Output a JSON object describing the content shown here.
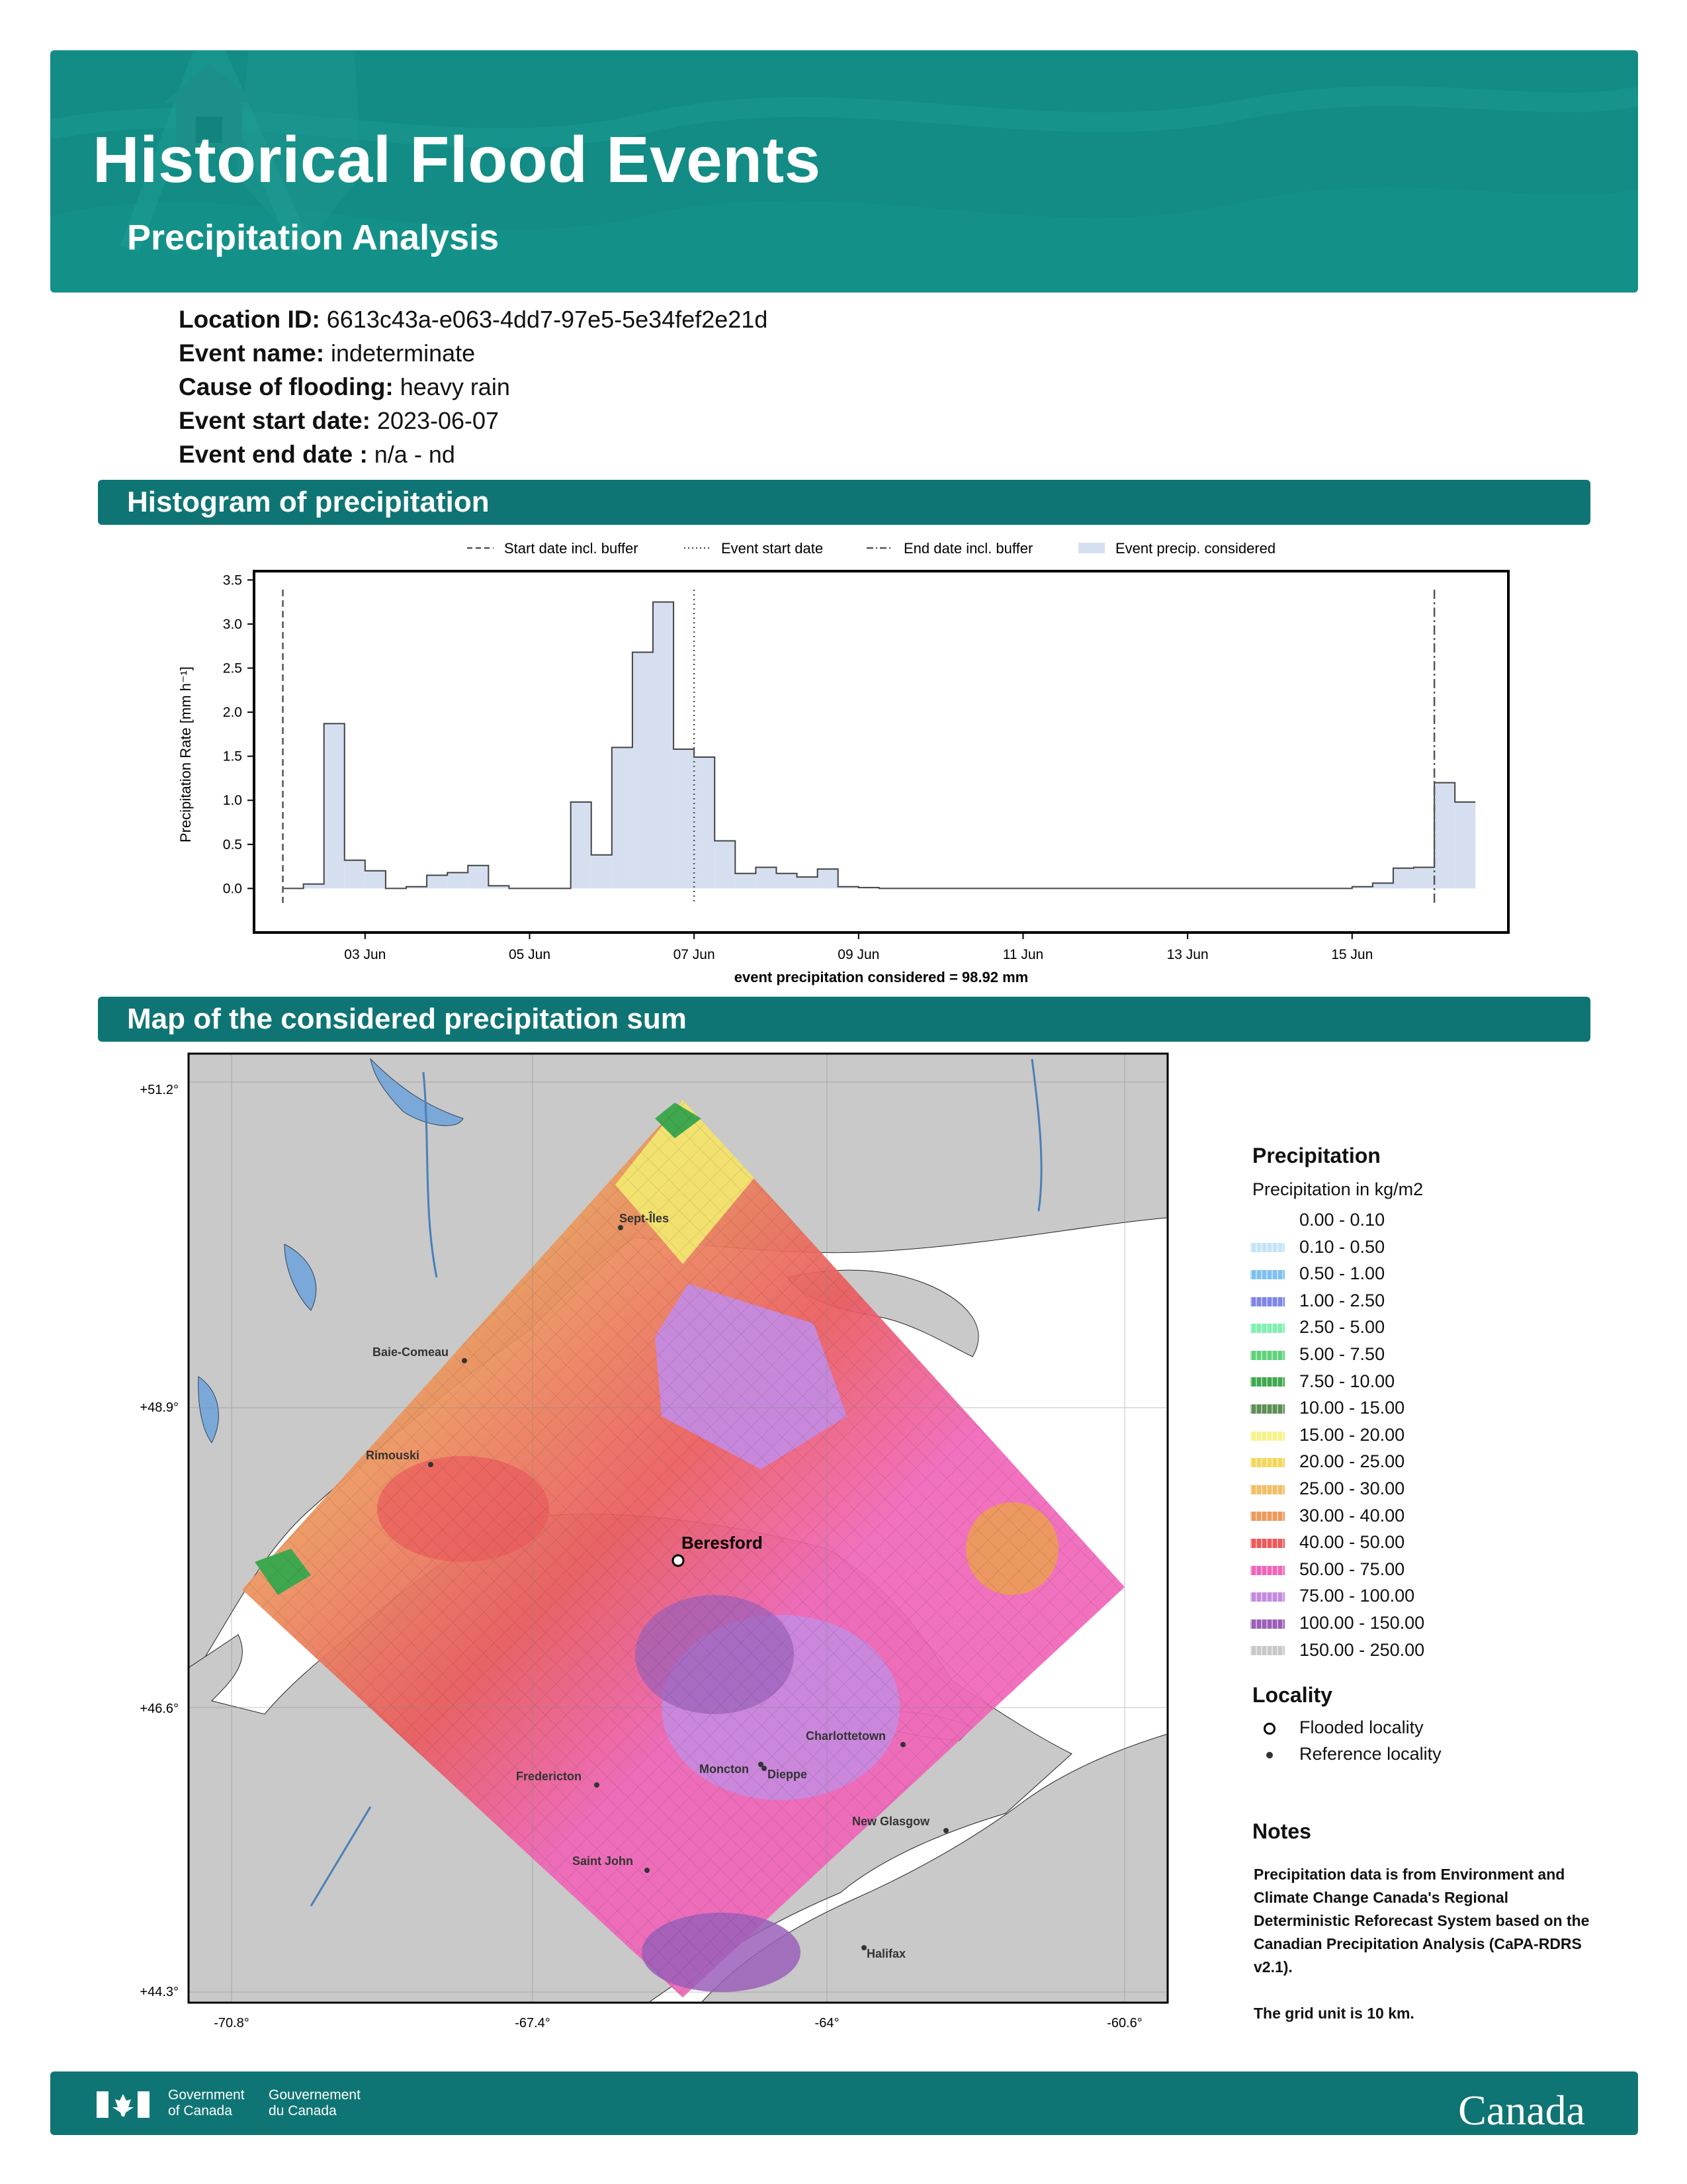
{
  "header": {
    "title": "Historical Flood Events",
    "subtitle": "Precipitation Analysis"
  },
  "event": {
    "location_id_label": "Location ID:",
    "location_id": "6613c43a-e063-4dd7-97e5-5e34fef2e21d",
    "event_name_label": "Event name:",
    "event_name": "indeterminate",
    "cause_label": "Cause of flooding:",
    "cause": "heavy rain",
    "start_label": "Event start date:",
    "start": "2023-06-07",
    "end_label": "Event end date :",
    "end": "n/a - nd"
  },
  "sections": {
    "histogram": "Histogram of precipitation",
    "map": "Map of the considered precipitation sum"
  },
  "chart_data": {
    "type": "bar",
    "ylabel": "Precipitation Rate [mm h⁻¹]",
    "xlabel": "event precipitation considered = 98.92 mm",
    "ylim": [
      -0.5,
      3.6
    ],
    "yticks": [
      "0.0",
      "0.5",
      "1.0",
      "1.5",
      "2.0",
      "2.5",
      "3.0",
      "3.5"
    ],
    "xticks": [
      {
        "label": "03 Jun",
        "day": 3
      },
      {
        "label": "05 Jun",
        "day": 5
      },
      {
        "label": "07 Jun",
        "day": 7
      },
      {
        "label": "09 Jun",
        "day": 9
      },
      {
        "label": "11 Jun",
        "day": 11
      },
      {
        "label": "13 Jun",
        "day": 13
      },
      {
        "label": "15 Jun",
        "day": 15
      }
    ],
    "legend": [
      {
        "label": "Start date incl. buffer",
        "style": "dashed"
      },
      {
        "label": "Event start date",
        "style": "dotted"
      },
      {
        "label": "End date incl. buffer",
        "style": "dashdot"
      },
      {
        "label": "Event precip. considered",
        "style": "fill"
      }
    ],
    "start_buffer_day": 2.0,
    "event_start_day": 7.0,
    "end_buffer_day": 16.0,
    "bin_hours": 6,
    "first_bin_day": 2.0,
    "values": [
      0.0,
      0.05,
      1.87,
      0.32,
      0.2,
      0.0,
      0.02,
      0.15,
      0.18,
      0.26,
      0.03,
      0.0,
      0.0,
      0.0,
      0.98,
      0.38,
      1.6,
      2.68,
      3.25,
      1.58,
      1.49,
      0.54,
      0.17,
      0.24,
      0.17,
      0.13,
      0.22,
      0.02,
      0.01,
      0.0,
      0.0,
      0.0,
      0.0,
      0.0,
      0.0,
      0.0,
      0.0,
      0.0,
      0.0,
      0.0,
      0.0,
      0.0,
      0.0,
      0.0,
      0.0,
      0.0,
      0.0,
      0.0,
      0.0,
      0.0,
      0.0,
      0.0,
      0.02,
      0.06,
      0.23,
      0.24,
      1.2,
      0.98
    ],
    "fill_color": "#d5dff0",
    "line_color": "#444444"
  },
  "map": {
    "lat_labels": [
      "+51.2°",
      "+48.9°",
      "+46.6°",
      "+44.3°"
    ],
    "lon_labels": [
      "-70.8°",
      "-67.4°",
      "-64°",
      "-60.6°"
    ],
    "flooded_locality": "Beresford",
    "reference_localities": [
      "Sept-Îles",
      "Baie-Comeau",
      "Rimouski",
      "Charlottetown",
      "Moncton",
      "Dieppe",
      "Fredericton",
      "New Glasgow",
      "Saint John",
      "Halifax"
    ]
  },
  "legend": {
    "precip_title": "Precipitation",
    "precip_subtitle": "Precipitation in kg/m2",
    "classes": [
      {
        "label": "0.00 - 0.10",
        "color": "#ffffff"
      },
      {
        "label": "0.10 - 0.50",
        "color": "#c6e4f7"
      },
      {
        "label": "0.50 - 1.00",
        "color": "#7fc0ef"
      },
      {
        "label": "1.00 - 2.50",
        "color": "#7f86e6"
      },
      {
        "label": "2.50 - 5.00",
        "color": "#7ff0b0"
      },
      {
        "label": "5.00 - 7.50",
        "color": "#5fd27a"
      },
      {
        "label": "7.50 - 10.00",
        "color": "#3fa84f"
      },
      {
        "label": "10.00 - 15.00",
        "color": "#5e8f55"
      },
      {
        "label": "15.00 - 20.00",
        "color": "#f6f38a"
      },
      {
        "label": "20.00 - 25.00",
        "color": "#f2d75c"
      },
      {
        "label": "25.00 - 30.00",
        "color": "#f2be66"
      },
      {
        "label": "30.00 - 40.00",
        "color": "#ec9a5c"
      },
      {
        "label": "40.00 - 50.00",
        "color": "#ea5a5c"
      },
      {
        "label": "50.00 - 75.00",
        "color": "#f065b8"
      },
      {
        "label": "75.00 - 100.00",
        "color": "#c58ae0"
      },
      {
        "label": "100.00 - 150.00",
        "color": "#9a5fb8"
      },
      {
        "label": "150.00 - 250.00",
        "color": "#c8c8c8"
      }
    ],
    "locality_title": "Locality",
    "flooded_label": "Flooded locality",
    "reference_label": "Reference locality"
  },
  "notes": {
    "title": "Notes",
    "text1": "Precipitation data is from Environment and Climate Change Canada's Regional Deterministic Reforecast System based on the Canadian Precipitation Analysis (CaPA-RDRS v2.1).",
    "text2": "The grid unit is 10 km."
  },
  "footer": {
    "gov_en_1": "Government",
    "gov_en_2": "of Canada",
    "gov_fr_1": "Gouvernement",
    "gov_fr_2": "du Canada",
    "wordmark": "Canada"
  }
}
